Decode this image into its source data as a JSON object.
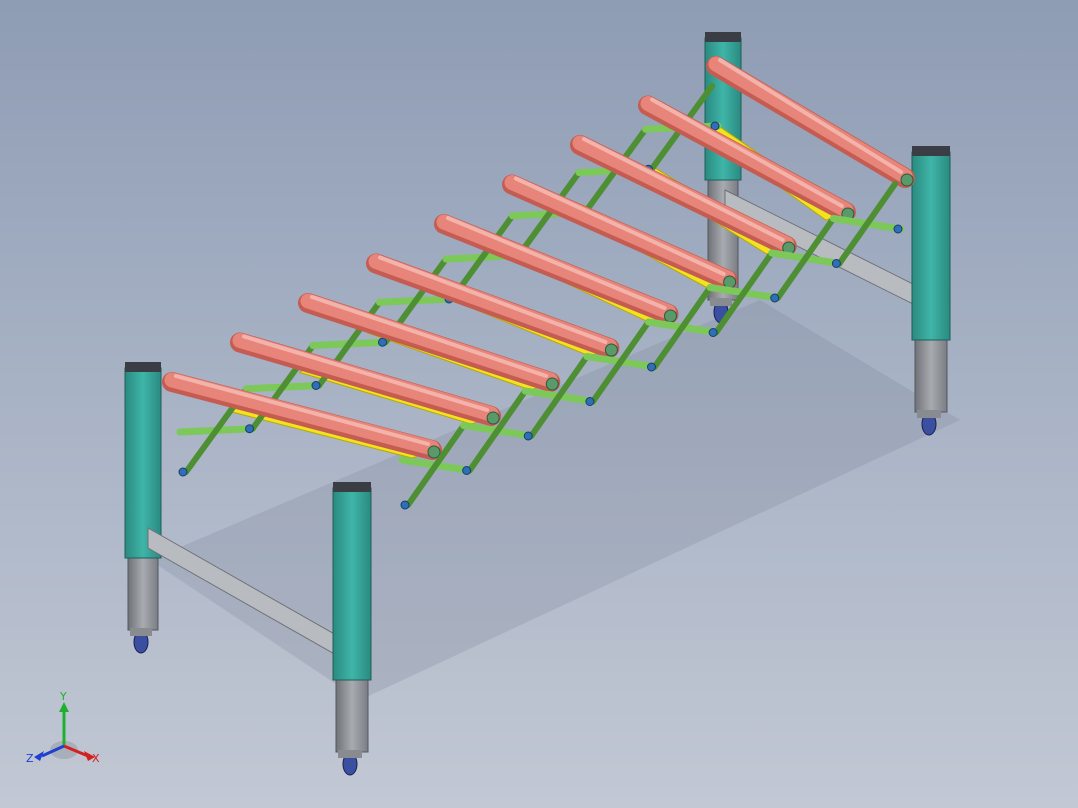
{
  "view": {
    "background_top": "#8e9cb4",
    "background_bottom": "#c2c8d4"
  },
  "model": {
    "roller_count": 9,
    "colors": {
      "roller": "#e8857a",
      "roller_highlight": "#f4b3aa",
      "roller_shadow": "#c45c52",
      "scissor_link": "#7cc95a",
      "scissor_link_dark": "#4e8f33",
      "leg_upper": "#3fb5a8",
      "leg_upper_dark": "#2a8a80",
      "leg_lower": "#9a9da3",
      "crossbar": "#b8bbc0",
      "pad": "#f2e320",
      "caster_wheel": "#3a4fa0",
      "bolt": "#2e6fb8"
    }
  },
  "triad": {
    "x_label": "X",
    "y_label": "Y",
    "z_label": "Z",
    "x_color": "#d42020",
    "y_color": "#20b030",
    "z_color": "#2040d0"
  }
}
